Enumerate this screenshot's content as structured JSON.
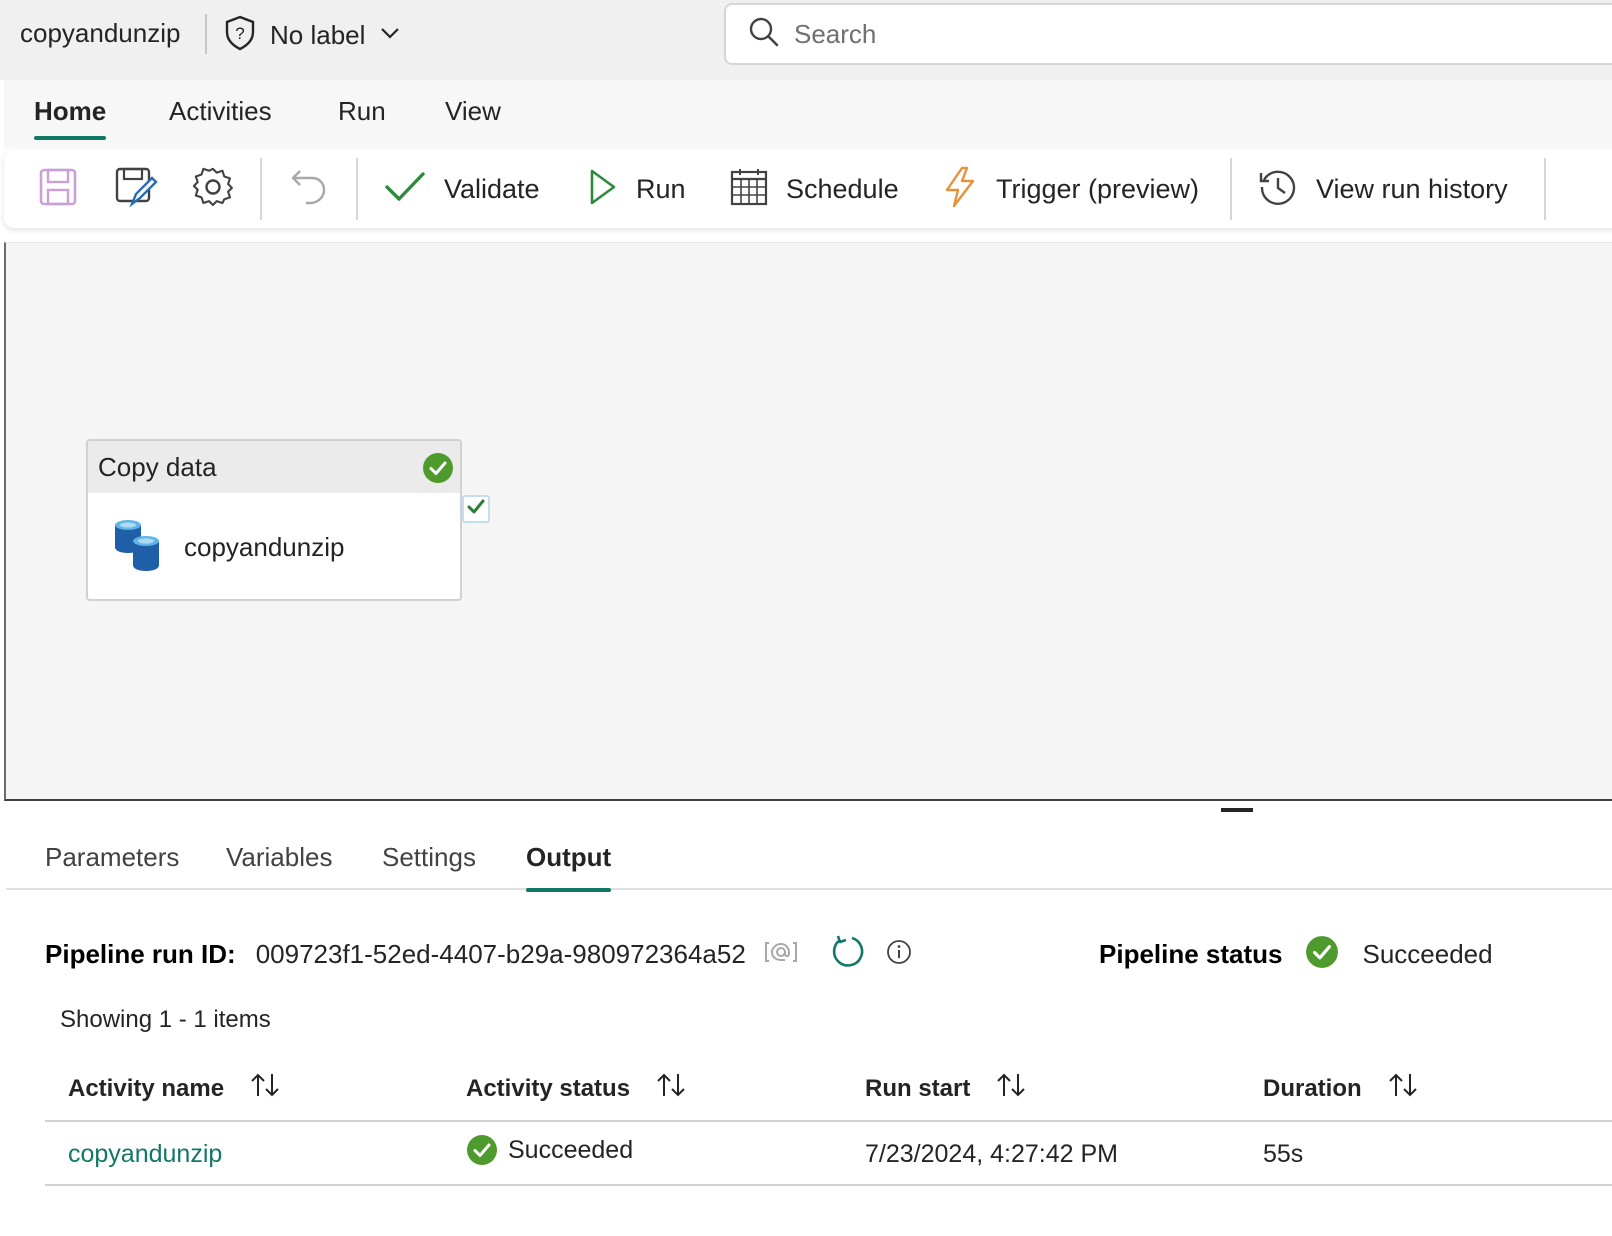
{
  "header": {
    "doc_title": "copyandunzip",
    "sensitivity_label": "No label",
    "search_placeholder": "Search"
  },
  "ribbon": {
    "tabs": [
      "Home",
      "Activities",
      "Run",
      "View"
    ],
    "active_tab": "Home"
  },
  "toolbar": {
    "validate_label": "Validate",
    "run_label": "Run",
    "schedule_label": "Schedule",
    "trigger_label": "Trigger (preview)",
    "history_label": "View run history"
  },
  "canvas": {
    "activity": {
      "type": "Copy data",
      "name": "copyandunzip",
      "status_icon": "success-check-icon"
    }
  },
  "panel": {
    "tabs": [
      "Parameters",
      "Variables",
      "Settings",
      "Output"
    ],
    "active_tab": "Output",
    "run_id_label": "Pipeline run ID:",
    "run_id": "009723f1-52ed-4407-b29a-980972364a52",
    "status_label": "Pipeline status",
    "status_value": "Succeeded",
    "showing_text": "Showing 1 - 1 items",
    "table": {
      "columns": [
        "Activity name",
        "Activity status",
        "Run start",
        "Duration"
      ],
      "rows": [
        {
          "activity_name": "copyandunzip",
          "activity_status": "Succeeded",
          "run_start": "7/23/2024, 4:27:42 PM",
          "duration": "55s"
        }
      ]
    }
  },
  "colors": {
    "accent": "#117865",
    "success": "#4f9a2d",
    "trigger": "#e8913a",
    "save_disabled": "#c9a0d8"
  }
}
